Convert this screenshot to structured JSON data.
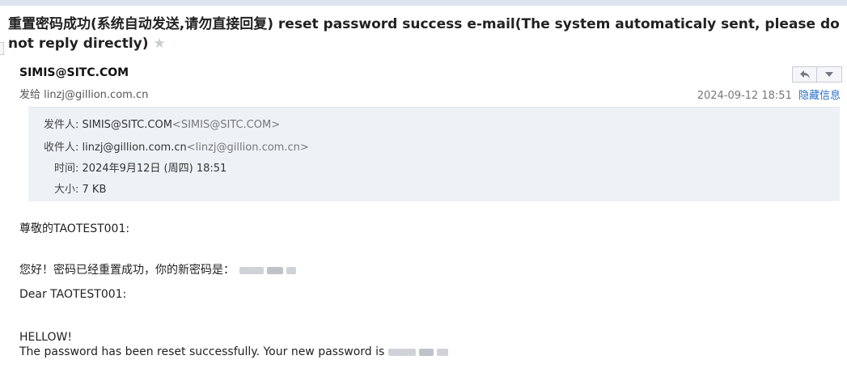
{
  "subject": {
    "text": "重置密码成功(系统自动发送,请勿直接回复) reset password success e-mail(The system automaticaly sent, please do not reply directly)"
  },
  "header": {
    "sender": "SIMIS@SITC.COM",
    "to_line": "发给 linzj@gillion.com.cn",
    "datetime": "2024-09-12 18:51",
    "hide_details": "隐藏信息",
    "reply_icon": "reply-icon",
    "more_icon": "dropdown-icon"
  },
  "details": {
    "from_label": "发件人:",
    "from_name": "SIMIS@SITC.COM",
    "from_addr": "<SIMIS@SITC.COM>",
    "to_label": "收件人:",
    "to_name": "linzj@gillion.com.cn",
    "to_addr": "<linzj@gillion.com.cn>",
    "time_label": "时间:",
    "time_value": "2024年9月12日 (周四) 18:51",
    "size_label": "大小:",
    "size_value": "7 KB"
  },
  "body": {
    "greeting_cn": "尊敬的TAOTEST001:",
    "message_cn": "您好！密码已经重置成功，你的新密码是：",
    "greeting_en": "Dear TAOTEST001:",
    "hello_en": "HELLOW!",
    "message_en": "The password has been reset successfully. Your new password is"
  }
}
